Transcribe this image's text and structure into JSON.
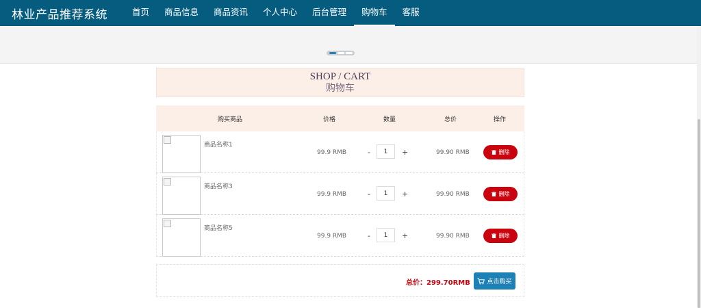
{
  "header": {
    "brand": "林业产品推荐系统",
    "nav": [
      "首页",
      "商品信息",
      "商品资讯",
      "个人中心",
      "后台管理",
      "购物车",
      "客服"
    ],
    "active_nav": "购物车"
  },
  "title": {
    "en": "SHOP / CART",
    "cn": "购物车"
  },
  "table": {
    "headers": {
      "product": "购买商品",
      "price": "价格",
      "quantity": "数量",
      "total": "总价",
      "action": "操作"
    },
    "rows": [
      {
        "name": "商品名称1",
        "price": "99.9 RMB",
        "qty": "1",
        "subtotal": "99.90 RMB",
        "delete_label": "删除"
      },
      {
        "name": "商品名称3",
        "price": "99.9 RMB",
        "qty": "1",
        "subtotal": "99.90 RMB",
        "delete_label": "删除"
      },
      {
        "name": "商品名称5",
        "price": "99.9 RMB",
        "qty": "1",
        "subtotal": "99.90 RMB",
        "delete_label": "删除"
      }
    ],
    "minus_label": "-",
    "plus_label": "+"
  },
  "summary": {
    "total": "总价：299.70RMB",
    "buy_label": "点击购买"
  },
  "colors": {
    "header_bg": "#055c7f",
    "accent_red": "#c9040f",
    "buy_blue": "#1e81b5",
    "title_bg": "#fbefe8"
  }
}
